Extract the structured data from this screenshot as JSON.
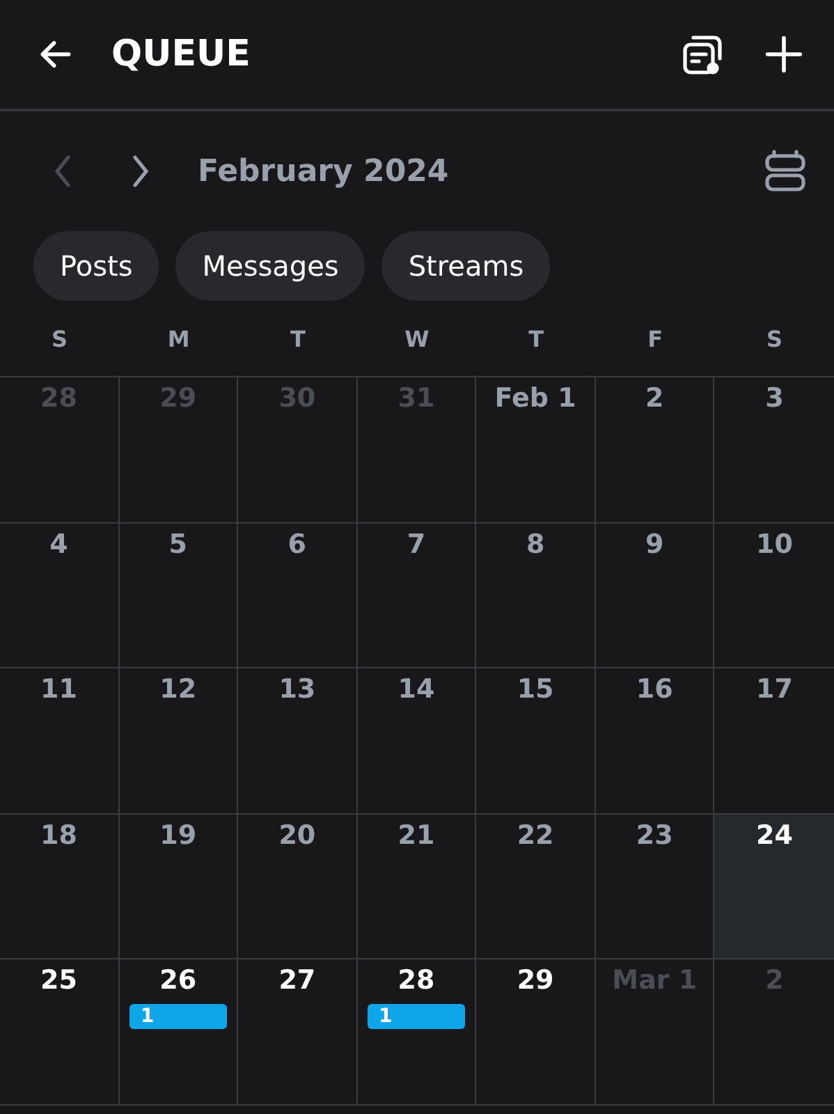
{
  "header": {
    "title": "QUEUE"
  },
  "nav": {
    "prev": {
      "disabled": true
    },
    "next": {
      "disabled": false
    },
    "month": "February 2024"
  },
  "filters": [
    {
      "label": "Posts",
      "selected": false
    },
    {
      "label": "Messages",
      "selected": false
    },
    {
      "label": "Streams",
      "selected": false
    }
  ],
  "weekdays": [
    "S",
    "M",
    "T",
    "W",
    "T",
    "F",
    "S"
  ],
  "weeks": [
    [
      {
        "label": "28",
        "kind": "other"
      },
      {
        "label": "29",
        "kind": "other"
      },
      {
        "label": "30",
        "kind": "other"
      },
      {
        "label": "31",
        "kind": "other"
      },
      {
        "label": "Feb 1",
        "kind": "past"
      },
      {
        "label": "2",
        "kind": "past"
      },
      {
        "label": "3",
        "kind": "past"
      }
    ],
    [
      {
        "label": "4",
        "kind": "past"
      },
      {
        "label": "5",
        "kind": "past"
      },
      {
        "label": "6",
        "kind": "past"
      },
      {
        "label": "7",
        "kind": "past"
      },
      {
        "label": "8",
        "kind": "past"
      },
      {
        "label": "9",
        "kind": "past"
      },
      {
        "label": "10",
        "kind": "past"
      }
    ],
    [
      {
        "label": "11",
        "kind": "past"
      },
      {
        "label": "12",
        "kind": "past"
      },
      {
        "label": "13",
        "kind": "past"
      },
      {
        "label": "14",
        "kind": "past"
      },
      {
        "label": "15",
        "kind": "past"
      },
      {
        "label": "16",
        "kind": "past"
      },
      {
        "label": "17",
        "kind": "past"
      }
    ],
    [
      {
        "label": "18",
        "kind": "past"
      },
      {
        "label": "19",
        "kind": "past"
      },
      {
        "label": "20",
        "kind": "past"
      },
      {
        "label": "21",
        "kind": "past"
      },
      {
        "label": "22",
        "kind": "past"
      },
      {
        "label": "23",
        "kind": "past"
      },
      {
        "label": "24",
        "kind": "today"
      }
    ],
    [
      {
        "label": "25",
        "kind": "future"
      },
      {
        "label": "26",
        "kind": "future",
        "count": "1"
      },
      {
        "label": "27",
        "kind": "future"
      },
      {
        "label": "28",
        "kind": "future",
        "count": "1"
      },
      {
        "label": "29",
        "kind": "future"
      },
      {
        "label": "Mar 1",
        "kind": "other"
      },
      {
        "label": "2",
        "kind": "other"
      }
    ]
  ]
}
